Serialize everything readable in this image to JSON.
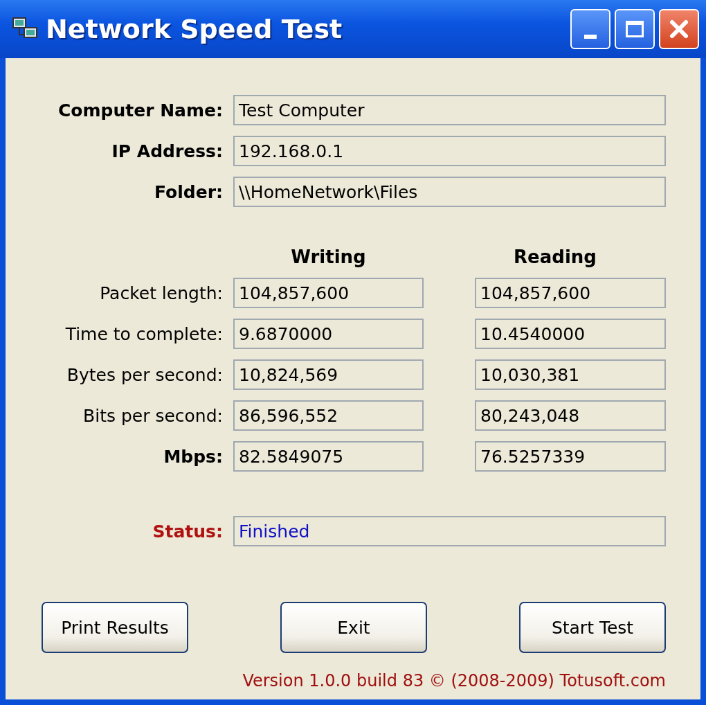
{
  "window": {
    "title": "Network Speed Test"
  },
  "info_fields": [
    {
      "label": "Computer Name:",
      "bold": true,
      "value": "Test Computer"
    },
    {
      "label": "IP Address:",
      "bold": true,
      "value": "192.168.0.1"
    },
    {
      "label": "Folder:",
      "bold": true,
      "value": "\\\\HomeNetwork\\Files"
    }
  ],
  "columns": [
    "Writing",
    "Reading"
  ],
  "measurements": [
    {
      "label": "Packet length:",
      "bold": false,
      "values": [
        "104,857,600",
        "104,857,600"
      ]
    },
    {
      "label": "Time to complete:",
      "bold": false,
      "values": [
        "9.6870000",
        "10.4540000"
      ]
    },
    {
      "label": "Bytes per second:",
      "bold": false,
      "values": [
        "10,824,569",
        "10,030,381"
      ]
    },
    {
      "label": "Bits per second:",
      "bold": false,
      "values": [
        "86,596,552",
        "80,243,048"
      ]
    },
    {
      "label": "Mbps:",
      "bold": true,
      "values": [
        "82.5849075",
        "76.5257339"
      ]
    }
  ],
  "status": {
    "label": "Status:",
    "value": "Finished"
  },
  "buttons": [
    "Print Results",
    "Exit",
    "Start Test"
  ],
  "footer": "Version 1.0.0 build 83 © (2008-2009) Totusoft.com"
}
